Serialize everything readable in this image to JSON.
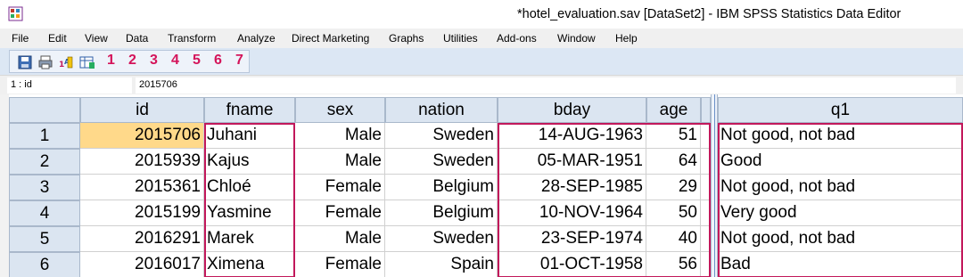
{
  "window": {
    "title": "*hotel_evaluation.sav [DataSet2] - IBM SPSS Statistics Data Editor"
  },
  "menu": [
    "File",
    "Edit",
    "View",
    "Data",
    "Transform",
    "Analyze",
    "Direct Marketing",
    "Graphs",
    "Utilities",
    "Add-ons",
    "Window",
    "Help"
  ],
  "toolbar": {
    "icons": [
      "save-icon",
      "print-icon",
      "variable-sets-icon",
      "value-labels-icon"
    ],
    "numbers": [
      "1",
      "2",
      "3",
      "4",
      "5",
      "6",
      "7"
    ],
    "number_color": "#d4145a"
  },
  "cell_editor": {
    "ref": "1 : id",
    "value": "2015706"
  },
  "grid": {
    "columns": [
      "id",
      "fname",
      "sex",
      "nation",
      "bday",
      "age",
      "q1"
    ],
    "rows": [
      {
        "n": "1",
        "id": "2015706",
        "fname": "Juhani",
        "sex": "Male",
        "nation": "Sweden",
        "bday": "14-AUG-1963",
        "age": "51",
        "q1": "Not good, not bad"
      },
      {
        "n": "2",
        "id": "2015939",
        "fname": "Kajus",
        "sex": "Male",
        "nation": "Sweden",
        "bday": "05-MAR-1951",
        "age": "64",
        "q1": "Good"
      },
      {
        "n": "3",
        "id": "2015361",
        "fname": "Chloé",
        "sex": "Female",
        "nation": "Belgium",
        "bday": "28-SEP-1985",
        "age": "29",
        "q1": "Not good, not bad"
      },
      {
        "n": "4",
        "id": "2015199",
        "fname": "Yasmine",
        "sex": "Female",
        "nation": "Belgium",
        "bday": "10-NOV-1964",
        "age": "50",
        "q1": "Very good"
      },
      {
        "n": "5",
        "id": "2016291",
        "fname": "Marek",
        "sex": "Male",
        "nation": "Sweden",
        "bday": "23-SEP-1974",
        "age": "40",
        "q1": "Not good, not bad"
      },
      {
        "n": "6",
        "id": "2016017",
        "fname": "Ximena",
        "sex": "Female",
        "nation": "Spain",
        "bday": "01-OCT-1958",
        "age": "56",
        "q1": "Bad"
      }
    ],
    "selection_color": "#ffd98a",
    "highlight_color": "#c2185b"
  }
}
